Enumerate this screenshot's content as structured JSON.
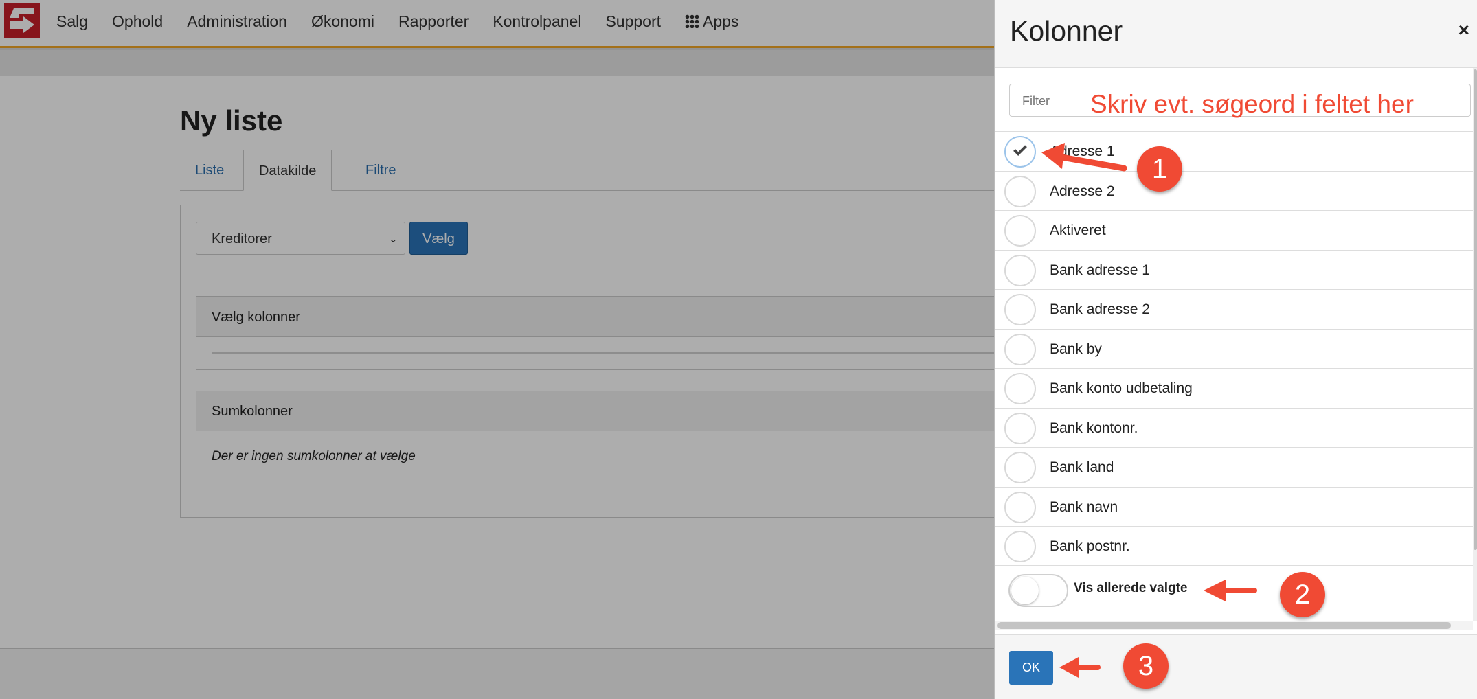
{
  "nav": {
    "items": [
      "Salg",
      "Ophold",
      "Administration",
      "Økonomi",
      "Rapporter",
      "Kontrolpanel",
      "Support"
    ],
    "apps": "Apps"
  },
  "page": {
    "title": "Ny liste",
    "tabs": [
      {
        "label": "Liste",
        "active": false
      },
      {
        "label": "Datakilde",
        "active": true
      },
      {
        "label": "Filtre",
        "active": false
      }
    ],
    "datasource_select": "Kreditorer",
    "select_button": "Vælg",
    "choose_columns_heading": "Vælg kolonner",
    "sum_columns_heading": "Sumkolonner",
    "sum_columns_empty": "Der er ingen sumkolonner at vælge"
  },
  "panel": {
    "title": "Kolonner",
    "close": "×",
    "filter_placeholder": "Filter",
    "filter_annotation": "Skriv evt. søgeord i feltet her",
    "columns": [
      {
        "label": "Adresse 1",
        "checked": true
      },
      {
        "label": "Adresse 2",
        "checked": false
      },
      {
        "label": "Aktiveret",
        "checked": false
      },
      {
        "label": "Bank adresse 1",
        "checked": false
      },
      {
        "label": "Bank adresse 2",
        "checked": false
      },
      {
        "label": "Bank by",
        "checked": false
      },
      {
        "label": "Bank konto udbetaling",
        "checked": false
      },
      {
        "label": "Bank kontonr.",
        "checked": false
      },
      {
        "label": "Bank land",
        "checked": false
      },
      {
        "label": "Bank navn",
        "checked": false
      },
      {
        "label": "Bank postnr.",
        "checked": false
      }
    ],
    "toggle_label": "Vis allerede valgte",
    "toggle_on": false,
    "ok_button": "OK"
  },
  "annotations": {
    "step1": "1",
    "step2": "2",
    "step3": "3"
  },
  "colors": {
    "accent_orange": "#f0a526",
    "primary_blue": "#2a74b8",
    "annotation_red": "#f04a34",
    "logo_red": "#c8202a"
  }
}
